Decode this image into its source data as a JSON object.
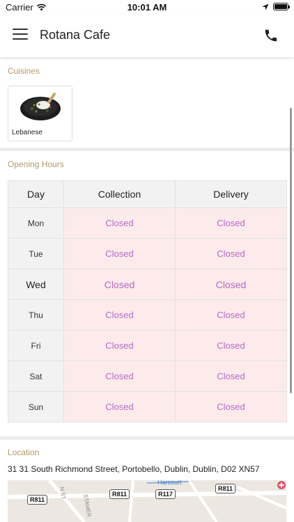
{
  "status_bar": {
    "carrier": "Carrier",
    "time": "10:01 AM",
    "icons": [
      "wifi-icon",
      "location-arrow-icon",
      "battery-icon"
    ]
  },
  "header": {
    "title": "Rotana Cafe",
    "menu_icon": "hamburger-menu-icon",
    "phone_icon": "phone-icon"
  },
  "cuisines": {
    "label": "Cuisines",
    "items": [
      {
        "name": "Lebanese",
        "image": "lebanese-dish-image"
      }
    ]
  },
  "opening_hours": {
    "label": "Opening Hours",
    "columns": [
      "Day",
      "Collection",
      "Delivery"
    ],
    "rows": [
      {
        "day": "Mon",
        "collection": "Closed",
        "delivery": "Closed"
      },
      {
        "day": "Tue",
        "collection": "Closed",
        "delivery": "Closed"
      },
      {
        "day": "Wed",
        "collection": "Closed",
        "delivery": "Closed"
      },
      {
        "day": "Thu",
        "collection": "Closed",
        "delivery": "Closed"
      },
      {
        "day": "Fri",
        "collection": "Closed",
        "delivery": "Closed"
      },
      {
        "day": "Sat",
        "collection": "Closed",
        "delivery": "Closed"
      },
      {
        "day": "Sun",
        "collection": "Closed",
        "delivery": "Closed"
      }
    ]
  },
  "location": {
    "label": "Location",
    "address": "31 31 South Richmond Street, Portobello, Dublin, Dublin, D02 XN57",
    "map": {
      "roads": [
        "R811",
        "R811",
        "R117",
        "R811"
      ],
      "labels": [
        "Harcourt",
        "N ST",
        "STAMER"
      ]
    }
  },
  "colors": {
    "accent_label": "#b39a6a",
    "closed_text": "#b46ac9",
    "closed_bg": "#fdebeb"
  }
}
